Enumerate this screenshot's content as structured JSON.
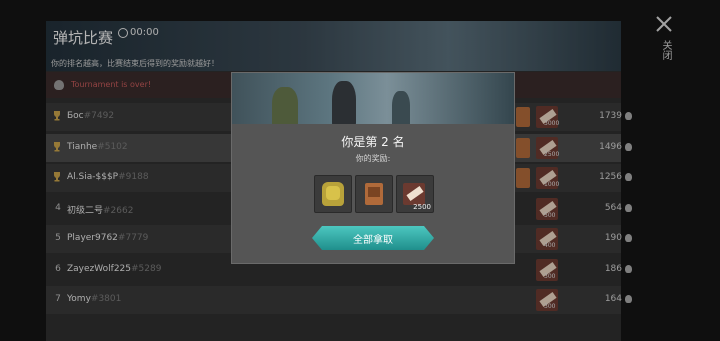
{
  "banner": {
    "title": "弹坑比赛",
    "timer": "00:00",
    "subtitle": "你的排名越高，比赛结束后得到的奖励就越好！"
  },
  "status": {
    "text": "Tournament is over!"
  },
  "rows": [
    {
      "rank": "",
      "trophy": true,
      "name": "Бос",
      "tag": "#7492",
      "score": "1739",
      "ticket_count": "3000",
      "box": true
    },
    {
      "rank": "",
      "trophy": true,
      "name": "Tianhe",
      "tag": "#5102",
      "score": "1496",
      "ticket_count": "2500",
      "box": true
    },
    {
      "rank": "",
      "trophy": true,
      "name": "Al.Sia-$$$P",
      "tag": "#9188",
      "score": "1256",
      "ticket_count": "1000",
      "box": true
    },
    {
      "rank": "4",
      "trophy": false,
      "name": "初级二号",
      "tag": "#2662",
      "score": "564",
      "ticket_count": "500",
      "box": false
    },
    {
      "rank": "5",
      "trophy": false,
      "name": "Player9762",
      "tag": "#7779",
      "score": "190",
      "ticket_count": "400",
      "box": false
    },
    {
      "rank": "6",
      "trophy": false,
      "name": "ZayezWolf225",
      "tag": "#5289",
      "score": "186",
      "ticket_count": "300",
      "box": false
    },
    {
      "rank": "7",
      "trophy": false,
      "name": "Yomy",
      "tag": "#3801",
      "score": "164",
      "ticket_count": "300",
      "box": false
    }
  ],
  "close": {
    "label": "关闭"
  },
  "modal": {
    "title": "你是第 2 名",
    "subtitle": "你的奖励:",
    "rewards": [
      {
        "icon": "backpack-icon"
      },
      {
        "icon": "crate-icon"
      },
      {
        "icon": "ticket-icon",
        "count": "2500"
      }
    ],
    "claim_label": "全部拿取"
  },
  "colors": {
    "accent": "#2fb3ad",
    "status_red": "#c45a5a",
    "trophy": "#c9a24a"
  }
}
